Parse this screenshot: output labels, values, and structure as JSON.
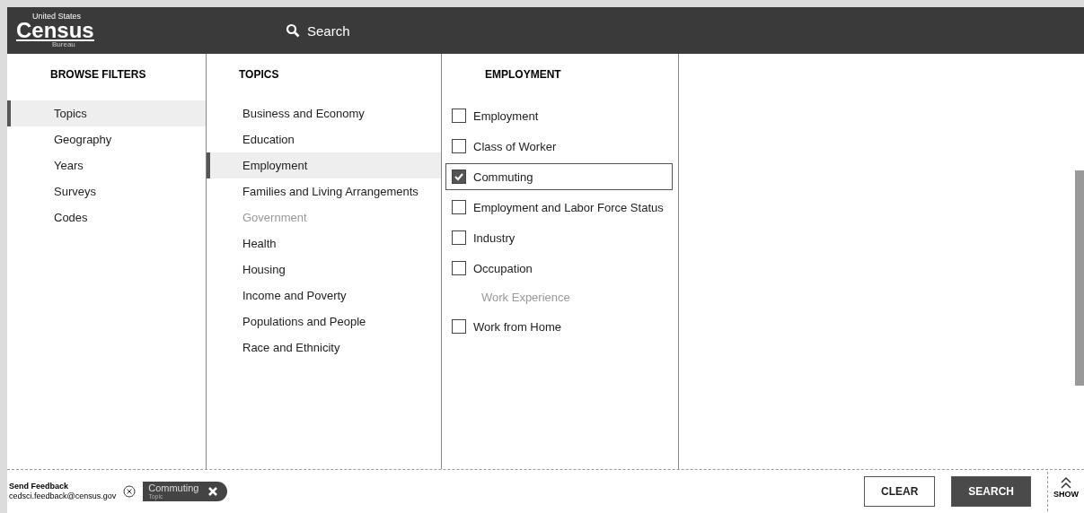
{
  "header": {
    "logo_small": "United States",
    "logo": "Census",
    "logo_sub": "Bureau",
    "search": {
      "placeholder": "Search"
    }
  },
  "browse_filters": {
    "title": "BROWSE FILTERS",
    "items": [
      {
        "label": "Topics",
        "selected": true
      },
      {
        "label": "Geography",
        "selected": false
      },
      {
        "label": "Years",
        "selected": false
      },
      {
        "label": "Surveys",
        "selected": false
      },
      {
        "label": "Codes",
        "selected": false
      }
    ]
  },
  "topics": {
    "title": "TOPICS",
    "items": [
      {
        "label": "Business and Economy",
        "selected": false,
        "disabled": false
      },
      {
        "label": "Education",
        "selected": false,
        "disabled": false
      },
      {
        "label": "Employment",
        "selected": true,
        "disabled": false
      },
      {
        "label": "Families and Living Arrangements",
        "selected": false,
        "disabled": false
      },
      {
        "label": "Government",
        "selected": false,
        "disabled": true
      },
      {
        "label": "Health",
        "selected": false,
        "disabled": false
      },
      {
        "label": "Housing",
        "selected": false,
        "disabled": false
      },
      {
        "label": "Income and Poverty",
        "selected": false,
        "disabled": false
      },
      {
        "label": "Populations and People",
        "selected": false,
        "disabled": false
      },
      {
        "label": "Race and Ethnicity",
        "selected": false,
        "disabled": false
      }
    ]
  },
  "employment": {
    "title": "EMPLOYMENT",
    "items": [
      {
        "kind": "checkbox",
        "label": "Employment",
        "checked": false
      },
      {
        "kind": "checkbox",
        "label": "Class of Worker",
        "checked": false
      },
      {
        "kind": "checkbox",
        "label": "Commuting",
        "checked": true
      },
      {
        "kind": "checkbox",
        "label": "Employment and Labor Force Status",
        "checked": false
      },
      {
        "kind": "checkbox",
        "label": "Industry",
        "checked": false
      },
      {
        "kind": "checkbox",
        "label": "Occupation",
        "checked": false
      },
      {
        "kind": "disabled",
        "label": "Work Experience"
      },
      {
        "kind": "checkbox",
        "label": "Work from Home",
        "checked": false
      }
    ]
  },
  "footer": {
    "feedback_title": "Send Feedback",
    "feedback_email": "cedsci.feedback@census.gov",
    "chips": [
      {
        "label": "Commuting",
        "sublabel": "Topic"
      }
    ],
    "clear": "CLEAR",
    "search": "SEARCH",
    "show": "SHOW"
  }
}
